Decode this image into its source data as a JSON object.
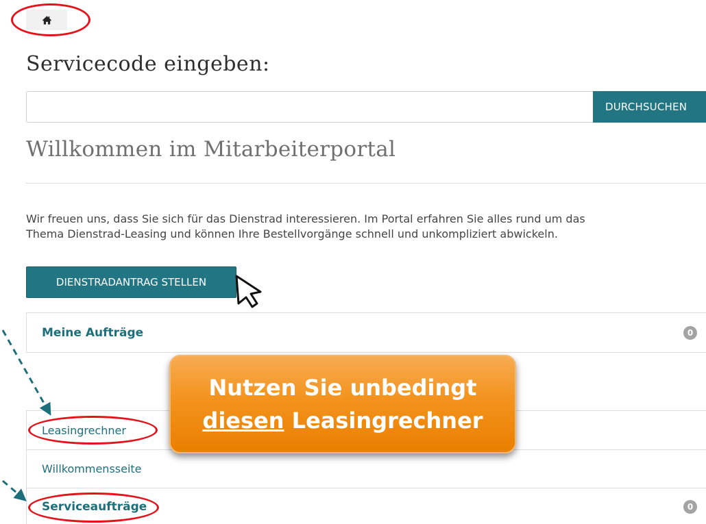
{
  "nav": {
    "home_icon": "home-icon"
  },
  "search": {
    "title": "Servicecode eingeben:",
    "input_value": "",
    "input_placeholder": "",
    "button_label": "DURCHSUCHEN"
  },
  "welcome": {
    "heading": "Willkommen im Mitarbeiterportal",
    "intro_line1": "Wir freuen uns, dass Sie sich für das Dienstrad interessieren. Im Portal erfahren Sie alles rund um das",
    "intro_line2": "Thema Dienstrad-Leasing und können Ihre Bestellvorgänge schnell und unkompliziert abwickeln.",
    "apply_button": "DIENSTRADANTRAG STELLEN"
  },
  "orders": {
    "label": "Meine Aufträge",
    "count": "0"
  },
  "links": {
    "leasing": "Leasingrechner",
    "welcome_page": "Willkommensseite",
    "service": {
      "label": "Serviceaufträge",
      "count": "0"
    }
  },
  "callout": {
    "line1": "Nutzen Sie unbedingt",
    "line2_underlined": "diesen",
    "line2_rest": " Leasingrechner"
  },
  "colors": {
    "accent": "#227583",
    "link": "#1d6f7b",
    "highlight_oval": "#e3131b",
    "callout_orange": "#f3931d",
    "badge": "#a3a3a3",
    "arrow": "#1d6f7b"
  }
}
